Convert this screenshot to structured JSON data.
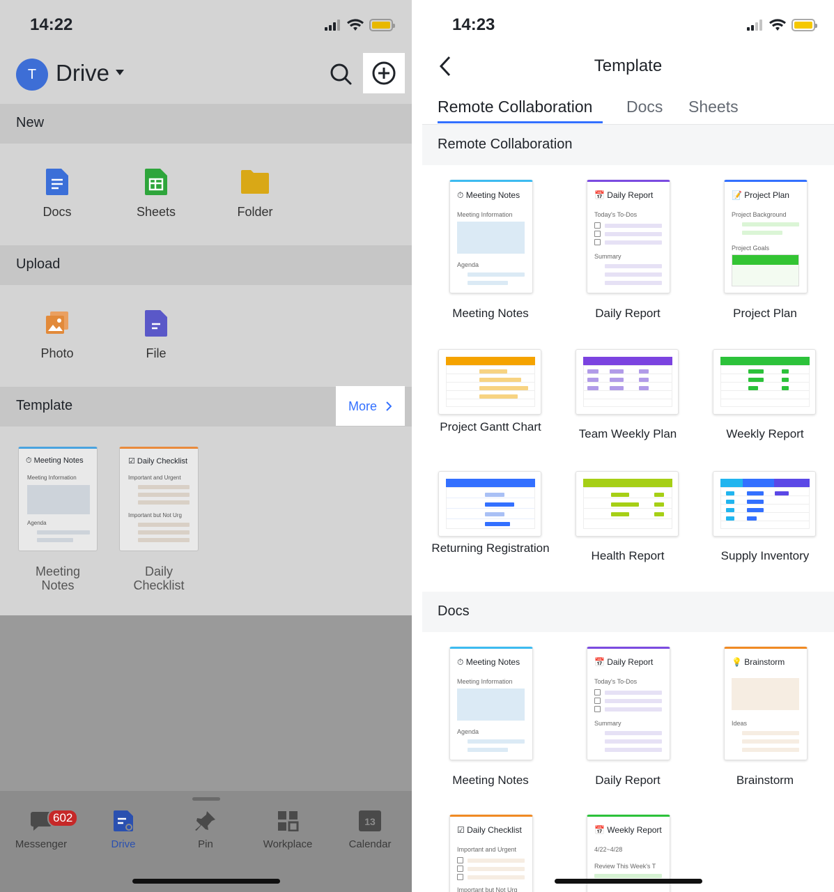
{
  "left": {
    "status_time": "14:22",
    "avatar_letter": "T",
    "title": "Drive",
    "sections": {
      "new": "New",
      "upload": "Upload",
      "template": "Template"
    },
    "new_items": [
      {
        "label": "Docs"
      },
      {
        "label": "Sheets"
      },
      {
        "label": "Folder"
      }
    ],
    "upload_items": [
      {
        "label": "Photo"
      },
      {
        "label": "File"
      }
    ],
    "more_label": "More",
    "templates": [
      {
        "title": "Meeting Notes",
        "sub1": "Meeting Information",
        "sub2": "Agenda",
        "label": "Meeting\nNotes"
      },
      {
        "title": "Daily Checklist",
        "sub1": "Important and Urgent",
        "sub2": "Important but Not Urg",
        "label": "Daily\nChecklist"
      }
    ],
    "tabbar": [
      {
        "label": "Messenger",
        "badge": "602"
      },
      {
        "label": "Drive"
      },
      {
        "label": "Pin"
      },
      {
        "label": "Workplace"
      },
      {
        "label": "Calendar",
        "day": "13"
      }
    ]
  },
  "right": {
    "status_time": "14:23",
    "title": "Template",
    "tabs": [
      "Remote Collaboration",
      "Docs",
      "Sheets"
    ],
    "section_remote": "Remote Collaboration",
    "section_docs": "Docs",
    "remote_docs": [
      {
        "title": "Meeting Notes",
        "sub1": "Meeting Information",
        "sub2": "Agenda",
        "label": "Meeting Notes"
      },
      {
        "title": "Daily Report",
        "sub1": "Today's To-Dos",
        "sub2": "Summary",
        "label": "Daily Report"
      },
      {
        "title": "Project Plan",
        "sub1": "Project Background",
        "sub2": "Project Goals",
        "label": "Project Plan"
      }
    ],
    "remote_sheets": [
      {
        "label": "Project Gantt Chart"
      },
      {
        "label": "Team Weekly Plan"
      },
      {
        "label": "Weekly Report"
      },
      {
        "label": "Returning Registration"
      },
      {
        "label": "Health Report"
      },
      {
        "label": "Supply Inventory"
      }
    ],
    "docs": [
      {
        "title": "Meeting Notes",
        "sub1": "Meeting Information",
        "sub2": "Agenda",
        "label": "Meeting Notes"
      },
      {
        "title": "Daily Report",
        "sub1": "Today's To-Dos",
        "sub2": "Summary",
        "label": "Daily Report"
      },
      {
        "title": "Brainstorm",
        "sub2": "Ideas",
        "label": "Brainstorm"
      },
      {
        "title": "Daily Checklist",
        "sub1": "Important and Urgent",
        "sub2": "Important but Not Urg"
      },
      {
        "title": "Weekly Report",
        "sub1": "4/22~4/28",
        "sub2": "Review This Week's T"
      }
    ]
  },
  "colors": {
    "accent": "#3370ff",
    "badge": "#e53935"
  }
}
